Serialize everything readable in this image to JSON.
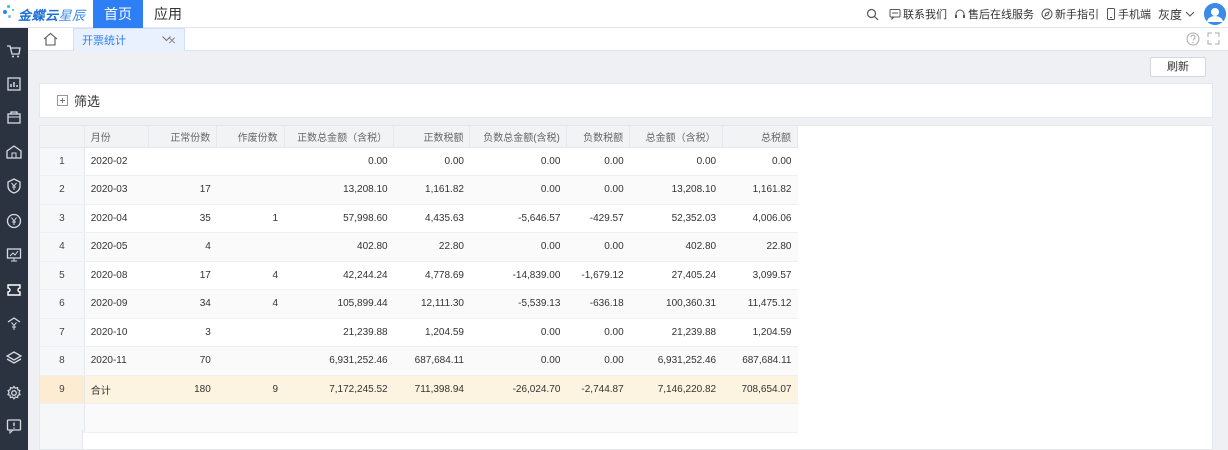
{
  "app": {
    "logo_bold": "金蝶云",
    "logo_thin": "星辰",
    "nav": [
      {
        "label": "首页",
        "active": true
      },
      {
        "label": "应用",
        "active": false
      }
    ],
    "header_links": {
      "contact": "联系我们",
      "support": "售后在线服务",
      "guide": "新手指引",
      "mobile": "手机端",
      "user": "灰度"
    }
  },
  "tabs": {
    "active_tab": "开票统计"
  },
  "toolbar": {
    "refresh_label": "刷新"
  },
  "filter": {
    "label": "筛选"
  },
  "table": {
    "columns": [
      "月份",
      "正常份数",
      "作废份数",
      "正数总金额（含税）",
      "正数税额",
      "负数总金额(含税)",
      "负数税额",
      "总金额（含税）",
      "总税额"
    ],
    "rows": [
      {
        "idx": "1",
        "month": "2020-02",
        "normal": "",
        "void": "",
        "pos_amount": "0.00",
        "pos_tax": "0.00",
        "neg_amount": "0.00",
        "neg_tax": "0.00",
        "total_amount": "0.00",
        "total_tax": "0.00"
      },
      {
        "idx": "2",
        "month": "2020-03",
        "normal": "17",
        "void": "",
        "pos_amount": "13,208.10",
        "pos_tax": "1,161.82",
        "neg_amount": "0.00",
        "neg_tax": "0.00",
        "total_amount": "13,208.10",
        "total_tax": "1,161.82"
      },
      {
        "idx": "3",
        "month": "2020-04",
        "normal": "35",
        "void": "1",
        "pos_amount": "57,998.60",
        "pos_tax": "4,435.63",
        "neg_amount": "-5,646.57",
        "neg_tax": "-429.57",
        "total_amount": "52,352.03",
        "total_tax": "4,006.06"
      },
      {
        "idx": "4",
        "month": "2020-05",
        "normal": "4",
        "void": "",
        "pos_amount": "402.80",
        "pos_tax": "22.80",
        "neg_amount": "0.00",
        "neg_tax": "0.00",
        "total_amount": "402.80",
        "total_tax": "22.80"
      },
      {
        "idx": "5",
        "month": "2020-08",
        "normal": "17",
        "void": "4",
        "pos_amount": "42,244.24",
        "pos_tax": "4,778.69",
        "neg_amount": "-14,839.00",
        "neg_tax": "-1,679.12",
        "total_amount": "27,405.24",
        "total_tax": "3,099.57"
      },
      {
        "idx": "6",
        "month": "2020-09",
        "normal": "34",
        "void": "4",
        "pos_amount": "105,899.44",
        "pos_tax": "12,111.30",
        "neg_amount": "-5,539.13",
        "neg_tax": "-636.18",
        "total_amount": "100,360.31",
        "total_tax": "11,475.12"
      },
      {
        "idx": "7",
        "month": "2020-10",
        "normal": "3",
        "void": "",
        "pos_amount": "21,239.88",
        "pos_tax": "1,204.59",
        "neg_amount": "0.00",
        "neg_tax": "0.00",
        "total_amount": "21,239.88",
        "total_tax": "1,204.59"
      },
      {
        "idx": "8",
        "month": "2020-11",
        "normal": "70",
        "void": "",
        "pos_amount": "6,931,252.46",
        "pos_tax": "687,684.11",
        "neg_amount": "0.00",
        "neg_tax": "0.00",
        "total_amount": "6,931,252.46",
        "total_tax": "687,684.11"
      },
      {
        "idx": "9",
        "month": "合计",
        "normal": "180",
        "void": "9",
        "pos_amount": "7,172,245.52",
        "pos_tax": "711,398.94",
        "neg_amount": "-26,024.70",
        "neg_tax": "-2,744.87",
        "total_amount": "7,146,220.82",
        "total_tax": "708,654.07"
      }
    ]
  },
  "sidebar": {
    "icons": [
      "cart-icon",
      "report-icon",
      "bag-icon",
      "warehouse-icon",
      "yen-shield-icon",
      "yen-circle-icon",
      "presentation-icon",
      "ticket-icon",
      "tax-icon",
      "layers-icon",
      "settings-icon",
      "alert-icon"
    ]
  },
  "colors": {
    "accent": "#2e7ff5",
    "sidebar_bg": "#2c3340",
    "total_row_bg": "#fdf3e1"
  }
}
